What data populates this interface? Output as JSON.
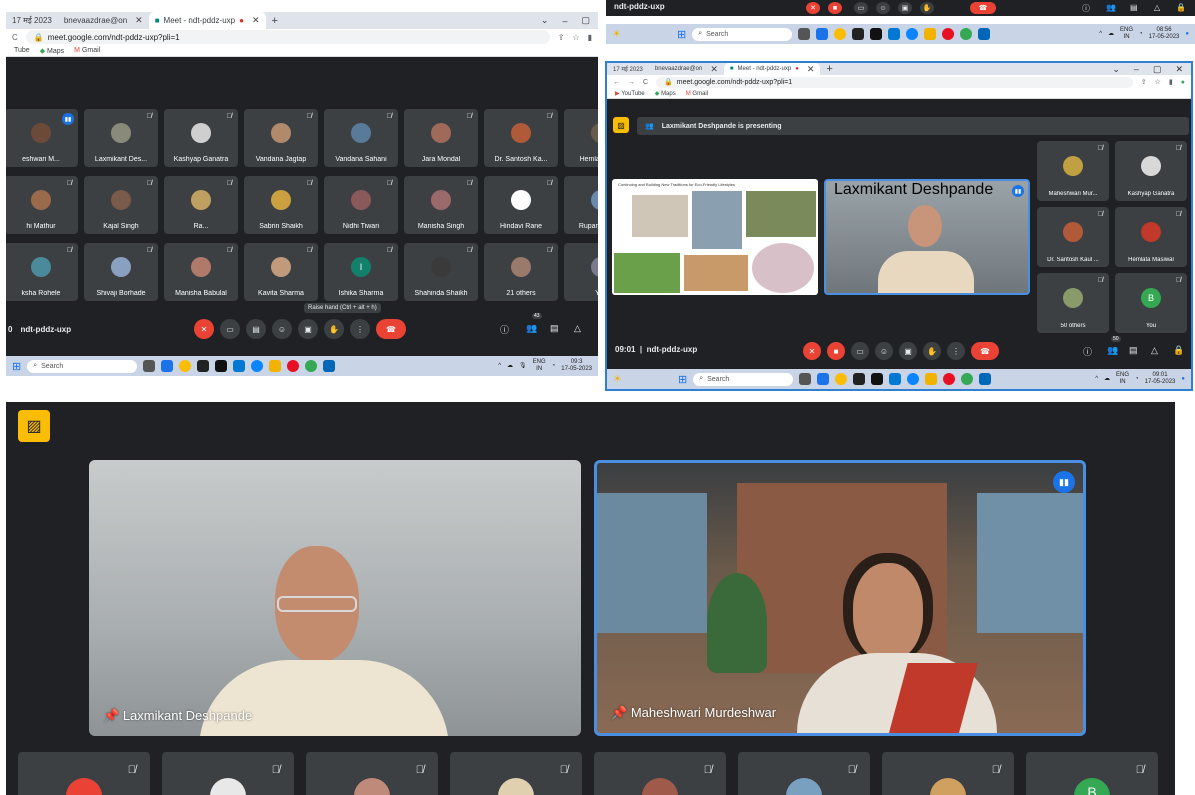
{
  "panel1": {
    "tabs": [
      {
        "label": "17 मई 2023"
      },
      {
        "label": "bnevaazdrae@on"
      },
      {
        "label": "Meet - ndt-pddz-uxp",
        "active": true
      }
    ],
    "url": "meet.google.com/ndt-pddz-uxp?pli=1",
    "bookmarks": [
      "Tube",
      "Maps",
      "Gmail"
    ],
    "participants": [
      {
        "name": "eshwari M...",
        "color": "#6b4a3a",
        "speaking": true
      },
      {
        "name": "Laxmikant Des...",
        "color": "#8a8a7a"
      },
      {
        "name": "Kashyap Ganatra",
        "color": "#cfcfcf"
      },
      {
        "name": "Vandana Jagtap",
        "color": "#b08a6a"
      },
      {
        "name": "Vandana Sahani",
        "color": "#5a7a9a"
      },
      {
        "name": "Jara Mondal",
        "color": "#a06a5a"
      },
      {
        "name": "Dr. Santosh Ka...",
        "color": "#b05a3a"
      },
      {
        "name": "Hemlata Masi",
        "color": "#6a5a4a"
      },
      {
        "name": "hi Mathur",
        "color": "#9a6a4a"
      },
      {
        "name": "Kajal Singh",
        "color": "#7a5a4a"
      },
      {
        "name": "Ra...",
        "color": "#c0a060"
      },
      {
        "name": "Sabrin Shaikh",
        "color": "#caa040"
      },
      {
        "name": "Nidhi Tiwari",
        "color": "#8a5a5a"
      },
      {
        "name": "Manisha Singh",
        "color": "#9a6a6a"
      },
      {
        "name": "Hindavi Rane",
        "color": "#ffffff"
      },
      {
        "name": "Rupam. Singh",
        "color": "#6a8aaa"
      },
      {
        "name": "ksha Rohele",
        "color": "#4a8a9a"
      },
      {
        "name": "Shivaji Borhade",
        "color": "#8aa0c0"
      },
      {
        "name": "Manisha Babulal",
        "color": "#b07a6a"
      },
      {
        "name": "Kavita Sharma",
        "color": "#c09a7a"
      },
      {
        "name": "Ishika Sharma",
        "color": "#12806a",
        "initial": "I"
      },
      {
        "name": "Shahinda Shaikh",
        "color": "#3a3a3a"
      },
      {
        "name": "21 others",
        "color": "#9a7a6a"
      },
      {
        "name": "You",
        "color": "#7a7a8a"
      }
    ],
    "meeting_code": "ndt-pddz-uxp",
    "tooltip": "Raise hand (Ctrl + alt + h)",
    "people_count": "43",
    "search_label": "Search",
    "tray_lang": "ENG",
    "tray_region": "IN",
    "time": "09:3",
    "date": "17-05-2023"
  },
  "panel_top_strip": {
    "meeting_code": "ndt-pddz-uxp",
    "tray_lang": "ENG",
    "tray_region": "IN",
    "time": "08:56",
    "date": "17-05-2023",
    "search_label": "Search"
  },
  "panel2": {
    "tabs": [
      {
        "label": "17 मई 2023"
      },
      {
        "label": "bnevaazdrae@on"
      },
      {
        "label": "Meet - ndt-pddz-uxp",
        "active": true
      }
    ],
    "url": "meet.google.com/ndt-pddz-uxp?pli=1",
    "bookmarks": [
      "YouTube",
      "Maps",
      "Gmail"
    ],
    "presenting_text": "Laxmikant Deshpande is presenting",
    "slide_title": "Continuing and Building New Traditions for Eco-Friendly Lifestyles",
    "presenter_name": "Laxmikant Deshpande",
    "participants": [
      {
        "name": "Maheshwari Mur...",
        "color": "#c0a040"
      },
      {
        "name": "Kashyap Ganatra",
        "color": "#d8d8d8"
      },
      {
        "name": "Dr. Santosh Kaul ...",
        "color": "#b05a3a"
      },
      {
        "name": "Hemlata Masiwal",
        "color": "#c0392b"
      },
      {
        "name": "50 others",
        "color": "#8a9a6a"
      },
      {
        "name": "You",
        "color": "#34a853",
        "initial": "B"
      }
    ],
    "time": "09:01",
    "meeting_code": "ndt-pddz-uxp",
    "people_count": "50",
    "search_label": "Search",
    "tray_lang": "ENG",
    "tray_region": "IN",
    "tray_time": "09:01",
    "date": "17-05-2023"
  },
  "panel3": {
    "speakers": [
      {
        "name": "Laxmikant Deshpande"
      },
      {
        "name": "Maheshwari Murdeshwar",
        "speaking": true
      }
    ],
    "strip_avatars": [
      {
        "color": "#ea4335"
      },
      {
        "color": "#e8e8e8"
      },
      {
        "color": "#c08a7a"
      },
      {
        "color": "#e0d0b0"
      },
      {
        "color": "#a05a4a"
      },
      {
        "color": "#7aa0c0"
      },
      {
        "color": "#d0a060"
      },
      {
        "color": "#34a853",
        "initial": "B"
      }
    ]
  }
}
